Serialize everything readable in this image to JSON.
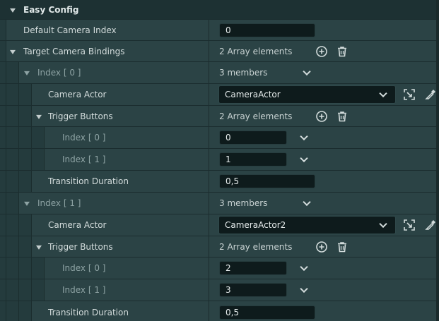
{
  "section": {
    "title": "Easy Config"
  },
  "default_camera": {
    "label": "Default Camera Index",
    "value": "0"
  },
  "bindings": {
    "label": "Target Camera Bindings",
    "summary": "2 Array elements"
  },
  "items": [
    {
      "index_label": "Index [ 0 ]",
      "summary": "3 members",
      "camera_label": "Camera Actor",
      "camera_value": "CameraActor",
      "trigger_label": "Trigger Buttons",
      "trigger_summary": "2 Array elements",
      "triggers": [
        {
          "label": "Index [ 0 ]",
          "value": "0"
        },
        {
          "label": "Index [ 1 ]",
          "value": "1"
        }
      ],
      "transition_label": "Transition Duration",
      "transition_value": "0,5"
    },
    {
      "index_label": "Index [ 1 ]",
      "summary": "3 members",
      "camera_label": "Camera Actor",
      "camera_value": "CameraActor2",
      "trigger_label": "Trigger Buttons",
      "trigger_summary": "2 Array elements",
      "triggers": [
        {
          "label": "Index [ 0 ]",
          "value": "2"
        },
        {
          "label": "Index [ 1 ]",
          "value": "3"
        }
      ],
      "transition_label": "Transition Duration",
      "transition_value": "0,5"
    }
  ],
  "icons": {
    "add": "plus-circle-icon",
    "delete": "trash-icon",
    "browse": "browse-to-asset-icon",
    "picker": "eyedropper-icon",
    "expand": "chevron-down-icon"
  },
  "colors": {
    "panel_bg": "#2b4345",
    "category_bg": "#1d3133",
    "field_bg": "#0e1b1c",
    "text": "#d3dcdc",
    "dim_text": "#8ea3a4"
  }
}
